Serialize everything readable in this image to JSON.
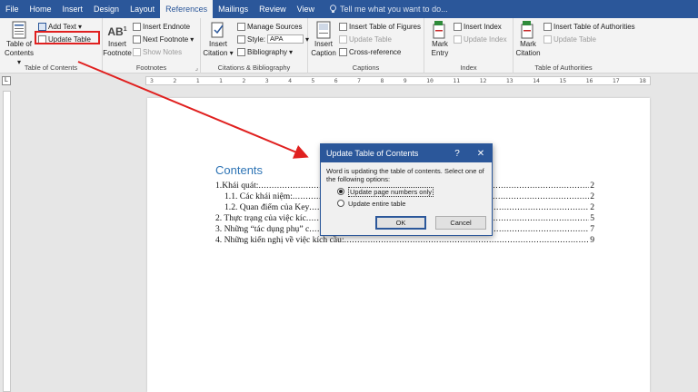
{
  "tabs": [
    "File",
    "Home",
    "Insert",
    "Design",
    "Layout",
    "References",
    "Mailings",
    "Review",
    "View"
  ],
  "active_tab": "References",
  "tell_me": "Tell me what you want to do...",
  "ribbon": {
    "toc": {
      "big_label_1": "Table of",
      "big_label_2": "Contents",
      "add_text": "Add Text",
      "update_table": "Update Table",
      "group": "Table of Contents"
    },
    "footnotes": {
      "insert_footnote_1": "Insert",
      "insert_footnote_2": "Footnote",
      "insert_endnote": "Insert Endnote",
      "next_footnote": "Next Footnote",
      "show_notes": "Show Notes",
      "group": "Footnotes",
      "icon_text": "AB",
      "icon_sup": "1"
    },
    "citations": {
      "insert_citation_1": "Insert",
      "insert_citation_2": "Citation",
      "manage_sources": "Manage Sources",
      "style_label": "Style:",
      "style_value": "APA",
      "bibliography": "Bibliography",
      "group": "Citations & Bibliography"
    },
    "captions": {
      "insert_caption_1": "Insert",
      "insert_caption_2": "Caption",
      "insert_table_of_figures": "Insert Table of Figures",
      "update_table": "Update Table",
      "cross_reference": "Cross-reference",
      "group": "Captions"
    },
    "index": {
      "mark_entry_1": "Mark",
      "mark_entry_2": "Entry",
      "insert_index": "Insert Index",
      "update_index": "Update Index",
      "group": "Index"
    },
    "authorities": {
      "mark_citation_1": "Mark",
      "mark_citation_2": "Citation",
      "insert_table_of_authorities": "Insert Table of Authorities",
      "update_table": "Update Table",
      "group": "Table of Authorities"
    }
  },
  "ruler": {
    "corner": "L",
    "marks": [
      "3",
      "2",
      "1",
      "1",
      "2",
      "3",
      "4",
      "5",
      "6",
      "7",
      "8",
      "9",
      "10",
      "11",
      "12",
      "13",
      "14",
      "15",
      "16",
      "17",
      "18"
    ]
  },
  "document": {
    "title": "Contents",
    "toc": [
      {
        "text": "1.Khái quát:",
        "page": "2",
        "level": 1
      },
      {
        "text": "1.1. Các khái niệm: ",
        "page": "2",
        "level": 2
      },
      {
        "text": "1.2. Quan điểm của Key",
        "page": "2",
        "level": 2
      },
      {
        "text": "2. Thực trạng của việc kíc",
        "page": "5",
        "level": 1
      },
      {
        "text": "3. Những “tác dụng phụ” c",
        "page": "7",
        "level": 1
      },
      {
        "text": "4. Những kiến nghị về việc kích cầu: ",
        "page": "9",
        "level": 1
      }
    ]
  },
  "dialog": {
    "title": "Update Table of Contents",
    "help": "?",
    "close": "✕",
    "message": "Word is updating the table of contents.  Select one of the following options:",
    "option_1": "Update page numbers only",
    "option_2": "Update entire table",
    "selected": 1,
    "ok": "OK",
    "cancel": "Cancel"
  },
  "colors": {
    "accent": "#2b579a",
    "heading": "#2e74b5",
    "highlight": "#e0201f"
  }
}
